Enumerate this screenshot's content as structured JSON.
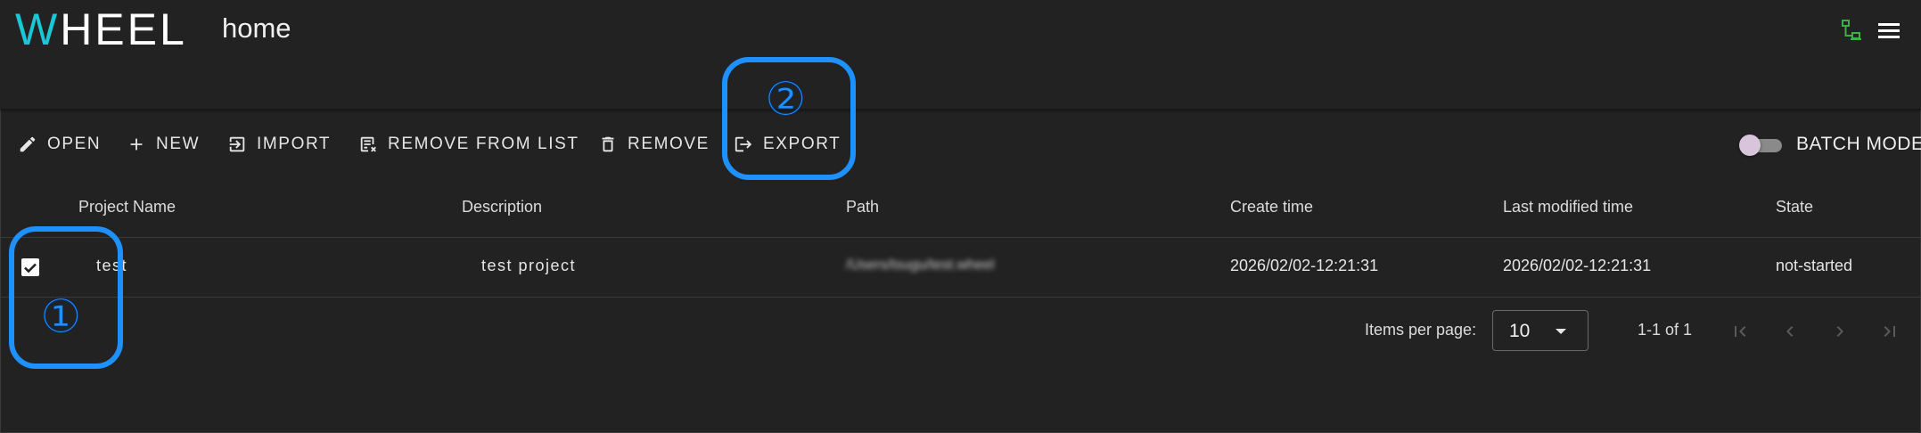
{
  "app": {
    "logo_w": "W",
    "logo_rest": "HEEL",
    "page_title": "home"
  },
  "header_icons": [
    "network-status-icon",
    "hamburger-menu-icon"
  ],
  "toolbar": {
    "open": "OPEN",
    "new": "NEW",
    "import": "IMPORT",
    "remove_from_list": "REMOVE FROM LIST",
    "remove": "REMOVE",
    "export": "EXPORT",
    "batch_mode": "BATCH MODE",
    "batch_mode_on": false
  },
  "table": {
    "columns": [
      "Project Name",
      "Description",
      "Path",
      "Create time",
      "Last modified time",
      "State"
    ],
    "rows": [
      {
        "selected": true,
        "name": "test",
        "description": "test project",
        "path": "/Users/tsugu/test.wheel",
        "create_time": "2026/02/02-12:21:31",
        "modified_time": "2026/02/02-12:21:31",
        "state": "not-started"
      }
    ]
  },
  "paginator": {
    "items_per_page_label": "Items per page:",
    "items_per_page": "10",
    "range": "1-1 of 1"
  },
  "annotations": {
    "one": "①",
    "two": "②"
  },
  "colors": {
    "accent": "#1e90ff",
    "logo_w": "#19c8d6",
    "background": "#222222",
    "net_icon": "#3cb043"
  }
}
